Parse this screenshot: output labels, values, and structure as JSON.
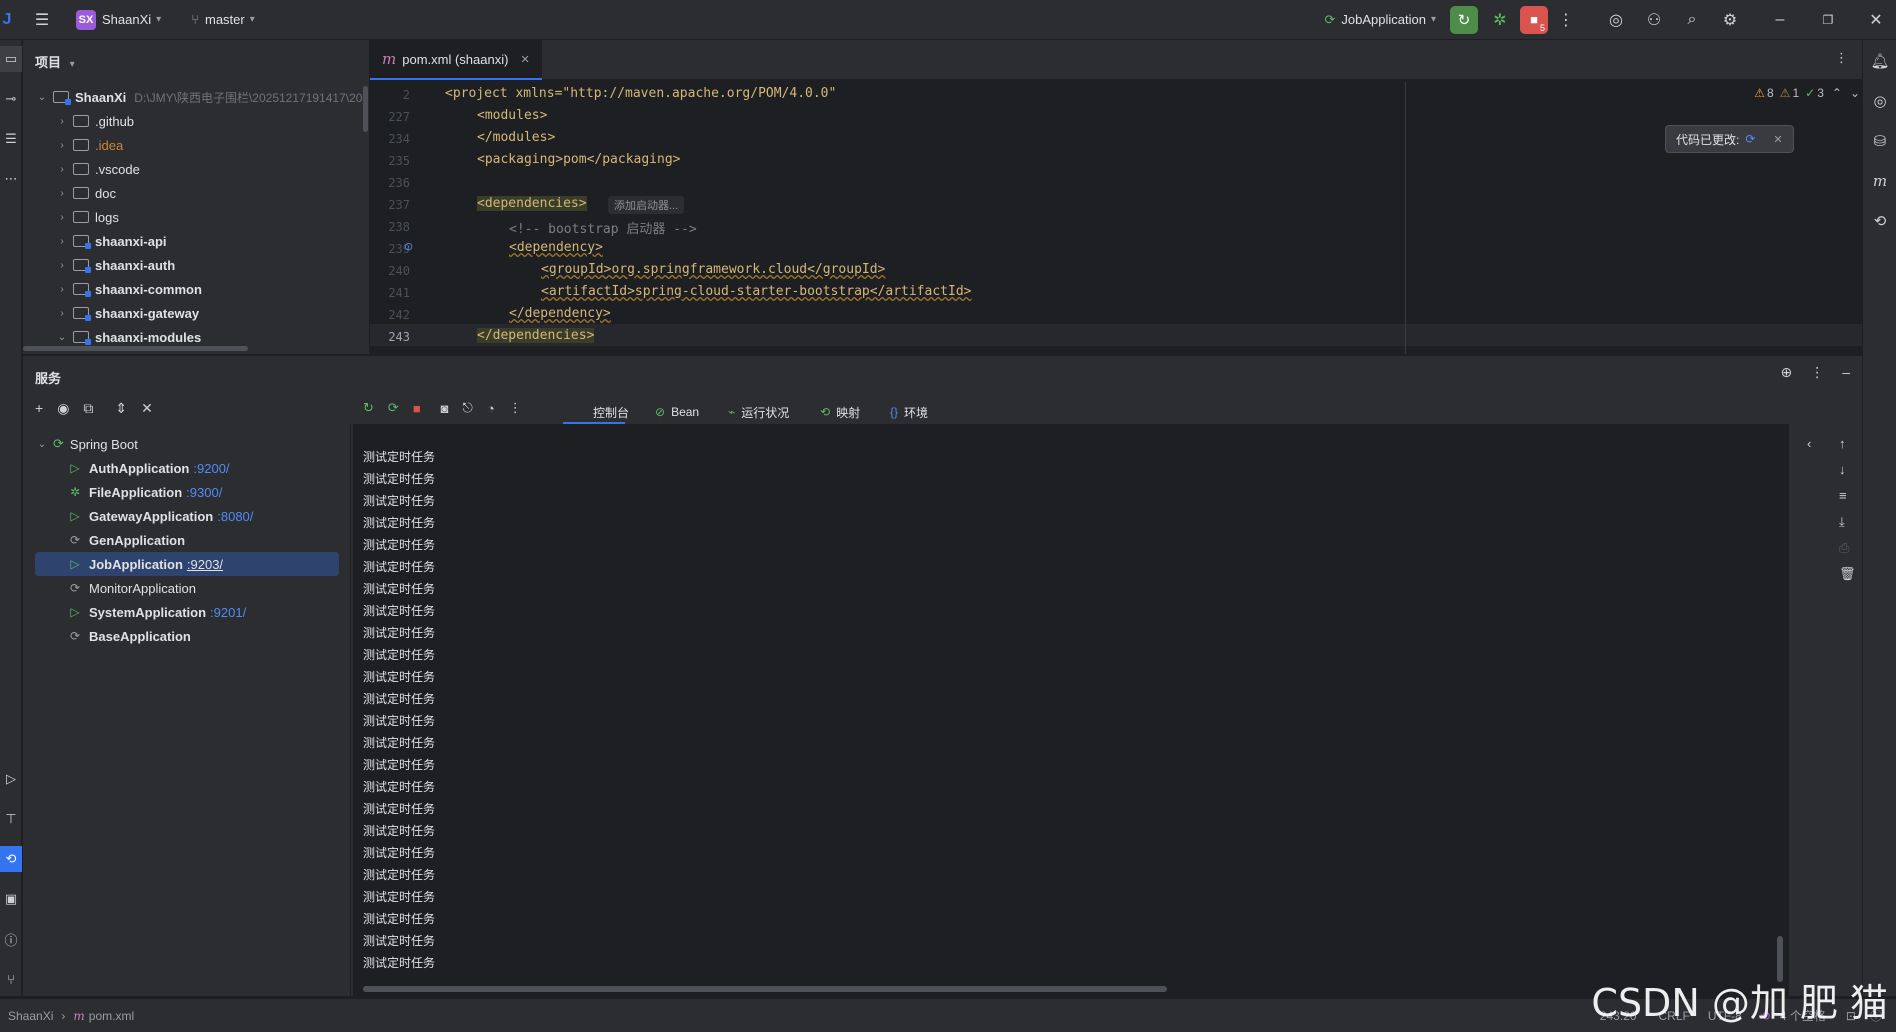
{
  "titlebar": {
    "project_initials": "SX",
    "project_name": "ShaanXi",
    "branch": "master",
    "run_config": "JobApplication",
    "stop_badge": "5"
  },
  "project_panel": {
    "title": "项目",
    "root": {
      "name": "ShaanXi",
      "path": "D:\\JMY\\陕西电子围栏\\20251217191417\\20"
    },
    "items": [
      {
        "label": ".github",
        "style": "normal"
      },
      {
        "label": ".idea",
        "style": "ignored"
      },
      {
        "label": ".vscode",
        "style": "normal"
      },
      {
        "label": "doc",
        "style": "normal"
      },
      {
        "label": "logs",
        "style": "normal"
      },
      {
        "label": "shaanxi-api",
        "style": "module"
      },
      {
        "label": "shaanxi-auth",
        "style": "module"
      },
      {
        "label": "shaanxi-common",
        "style": "module"
      },
      {
        "label": "shaanxi-gateway",
        "style": "module"
      },
      {
        "label": "shaanxi-modules",
        "style": "module"
      }
    ]
  },
  "editor": {
    "tab_label": "pom.xml (shaanxi)",
    "tab_icon": "m",
    "inspections": {
      "warnings": "8",
      "weak_warnings": "1",
      "ok": "3"
    },
    "notification": "代码已更改:",
    "lines": [
      {
        "num": "2",
        "text": "<project xmlns=\"http://maven.apache.org/POM/4.0.0\""
      },
      {
        "num": "227",
        "text": "<modules>"
      },
      {
        "num": "234",
        "text": "</modules>"
      },
      {
        "num": "235",
        "text": "<packaging>pom</packaging>"
      },
      {
        "num": "236",
        "text": ""
      },
      {
        "num": "237",
        "text": "<dependencies>"
      },
      {
        "num": "238",
        "text": "<!-- bootstrap 启动器 -->"
      },
      {
        "num": "239",
        "text": "<dependency>"
      },
      {
        "num": "240",
        "text": "<groupId>org.springframework.cloud</groupId>"
      },
      {
        "num": "241",
        "text": "<artifactId>spring-cloud-starter-bootstrap</artifactId>"
      },
      {
        "num": "242",
        "text": "</dependency>"
      },
      {
        "num": "243",
        "text": "</dependencies>"
      }
    ],
    "inlay_hint": "添加启动器..."
  },
  "services": {
    "title": "服务",
    "group": "Spring Boot",
    "apps": [
      {
        "name": "AuthApplication",
        "port": ":9200/",
        "state": "running"
      },
      {
        "name": "FileApplication",
        "port": ":9300/",
        "state": "debug"
      },
      {
        "name": "GatewayApplication",
        "port": ":8080/",
        "state": "running"
      },
      {
        "name": "GenApplication",
        "port": "",
        "state": "stopped"
      },
      {
        "name": "JobApplication",
        "port": ":9203/",
        "state": "selected"
      },
      {
        "name": "MonitorApplication",
        "port": "",
        "state": "idle"
      },
      {
        "name": "SystemApplication",
        "port": ":9201/",
        "state": "running"
      },
      {
        "name": "BaseApplication",
        "port": "",
        "state": "stopped"
      }
    ],
    "tool_tabs": [
      "控制台",
      "Bean",
      "运行状况",
      "映射",
      "环境"
    ],
    "console_line": "测试定时任务",
    "console_repeat": 24
  },
  "statusbar": {
    "breadcrumb_project": "ShaanXi",
    "breadcrumb_file": "pom.xml",
    "position": "243:20",
    "line_sep": "CRLF",
    "encoding": "UTF-8",
    "indent": "4 个空格"
  },
  "watermark": "CSDN @加 肥 猫",
  "colors": {
    "accent": "#3574f0",
    "run_green": "#5fb865",
    "stop_red": "#d9534f",
    "tag": "#d5b778",
    "string": "#6aab73"
  }
}
